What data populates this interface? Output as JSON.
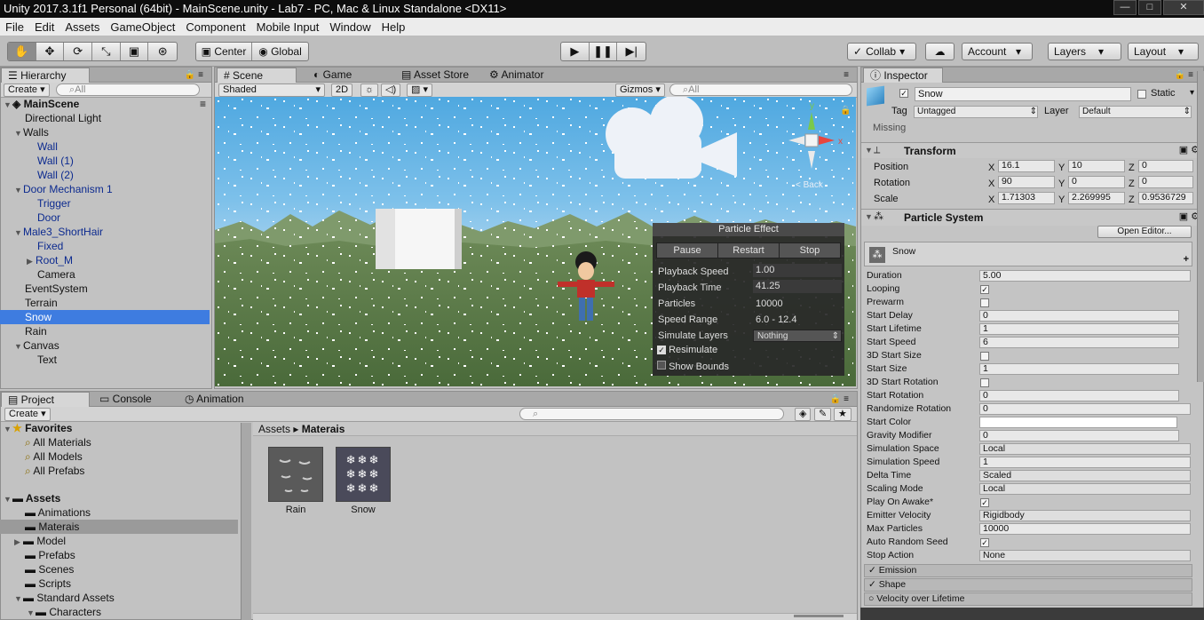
{
  "window": {
    "title": "Unity 2017.3.1f1 Personal (64bit) - MainScene.unity - Lab7 - PC, Mac & Linux Standalone <DX11>"
  },
  "menu": [
    "File",
    "Edit",
    "Assets",
    "GameObject",
    "Component",
    "Mobile Input",
    "Window",
    "Help"
  ],
  "toolbar": {
    "center": "Center",
    "global": "Global",
    "collab": "Collab",
    "account": "Account",
    "layers": "Layers",
    "layout": "Layout"
  },
  "hierarchy": {
    "tab": "Hierarchy",
    "create": "Create",
    "search_placeholder": "All",
    "scene": "MainScene",
    "items": [
      "Directional Light",
      "Walls",
      "Wall",
      "Wall (1)",
      "Wall (2)",
      "Door Mechanism 1",
      "Trigger",
      "Door",
      "Male3_ShortHair",
      "Fixed",
      "Root_M",
      "Camera",
      "EventSystem",
      "Terrain",
      "Snow",
      "Rain",
      "Canvas",
      "Text"
    ]
  },
  "scene": {
    "tabs": [
      "Scene",
      "Game",
      "Asset Store",
      "Animator"
    ],
    "shading": "Shaded",
    "mode_2d": "2D",
    "gizmos": "Gizmos",
    "search_placeholder": "All",
    "back_label": "< Back",
    "particle_effect": {
      "title": "Particle Effect",
      "pause": "Pause",
      "restart": "Restart",
      "stop": "Stop",
      "rows": [
        {
          "label": "Playback Speed",
          "value": "1.00"
        },
        {
          "label": "Playback Time",
          "value": "41.25"
        },
        {
          "label": "Particles",
          "value": "10000"
        },
        {
          "label": "Speed Range",
          "value": "6.0 - 12.4"
        },
        {
          "label": "Simulate Layers",
          "value": "Nothing"
        }
      ],
      "resimulate": "Resimulate",
      "show_bounds": "Show Bounds"
    }
  },
  "inspector": {
    "tab": "Inspector",
    "name": "Snow",
    "static": "Static",
    "tag_label": "Tag",
    "tag": "Untagged",
    "layer_label": "Layer",
    "layer": "Default",
    "missing": "Missing",
    "transform": {
      "title": "Transform",
      "rows": [
        {
          "label": "Position",
          "x": "16.1",
          "y": "10",
          "z": "0"
        },
        {
          "label": "Rotation",
          "x": "90",
          "y": "0",
          "z": "0"
        },
        {
          "label": "Scale",
          "x": "1.71303",
          "y": "2.269995",
          "z": "0.9536729"
        }
      ]
    },
    "particle_system": {
      "title": "Particle System",
      "open_editor": "Open Editor...",
      "module": "Snow",
      "props": [
        {
          "label": "Duration",
          "value": "5.00"
        },
        {
          "label": "Looping",
          "value": "✓"
        },
        {
          "label": "Prewarm",
          "value": ""
        },
        {
          "label": "Start Delay",
          "value": "0"
        },
        {
          "label": "Start Lifetime",
          "value": "1"
        },
        {
          "label": "Start Speed",
          "value": "6"
        },
        {
          "label": "3D Start Size",
          "value": ""
        },
        {
          "label": "Start Size",
          "value": "1"
        },
        {
          "label": "3D Start Rotation",
          "value": ""
        },
        {
          "label": "Start Rotation",
          "value": "0"
        },
        {
          "label": "Randomize Rotation",
          "value": "0"
        },
        {
          "label": "Start Color",
          "value": ""
        },
        {
          "label": "Gravity Modifier",
          "value": "0"
        },
        {
          "label": "Simulation Space",
          "value": "Local"
        },
        {
          "label": "Simulation Speed",
          "value": "1"
        },
        {
          "label": "Delta Time",
          "value": "Scaled"
        },
        {
          "label": "Scaling Mode",
          "value": "Local"
        },
        {
          "label": "Play On Awake*",
          "value": "✓"
        },
        {
          "label": "Emitter Velocity",
          "value": "Rigidbody"
        },
        {
          "label": "Max Particles",
          "value": "10000"
        },
        {
          "label": "Auto Random Seed",
          "value": "✓"
        },
        {
          "label": "Stop Action",
          "value": "None"
        }
      ],
      "modules": [
        "Emission",
        "Shape",
        "Velocity over Lifetime"
      ]
    }
  },
  "project": {
    "tabs": [
      "Project",
      "Console",
      "Animation"
    ],
    "create": "Create",
    "favorites": "Favorites",
    "fav_items": [
      "All Materials",
      "All Models",
      "All Prefabs"
    ],
    "assets": "Assets",
    "asset_items": [
      "Animations",
      "Materais",
      "Model",
      "Prefabs",
      "Scenes",
      "Scripts",
      "Standard Assets",
      "Characters"
    ],
    "breadcrumb": [
      "Assets",
      "Materais"
    ],
    "files": [
      "Rain",
      "Snow"
    ]
  }
}
